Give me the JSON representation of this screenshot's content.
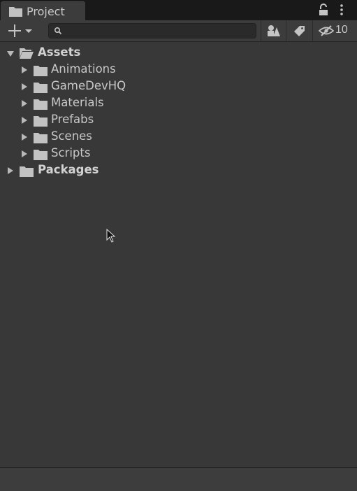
{
  "window": {
    "tab_title": "Project",
    "tab_icon": "folder-icon",
    "lock_icon": "lock-icon",
    "menu_icon": "kebab-icon"
  },
  "toolbar": {
    "create_icon": "plus-icon",
    "search_value": "",
    "search_placeholder": "",
    "filter_by_type_icon": "shapes-icon",
    "filter_by_label_icon": "tag-icon",
    "hidden_packages_icon": "eye-slash-icon",
    "hidden_packages_count": "10"
  },
  "tree": {
    "root": {
      "label": "Assets",
      "expanded": true
    },
    "children": [
      {
        "label": "Animations"
      },
      {
        "label": "GameDevHQ"
      },
      {
        "label": "Materials"
      },
      {
        "label": "Prefabs"
      },
      {
        "label": "Scenes"
      },
      {
        "label": "Scripts"
      }
    ],
    "packages": {
      "label": "Packages",
      "expanded": false
    }
  },
  "colors": {
    "panel_bg": "#383838",
    "tab_bar_bg": "#191919",
    "toolbar_bg": "#3c3c3c",
    "text": "#c8c8c8",
    "folder": "#c2c2c2"
  }
}
